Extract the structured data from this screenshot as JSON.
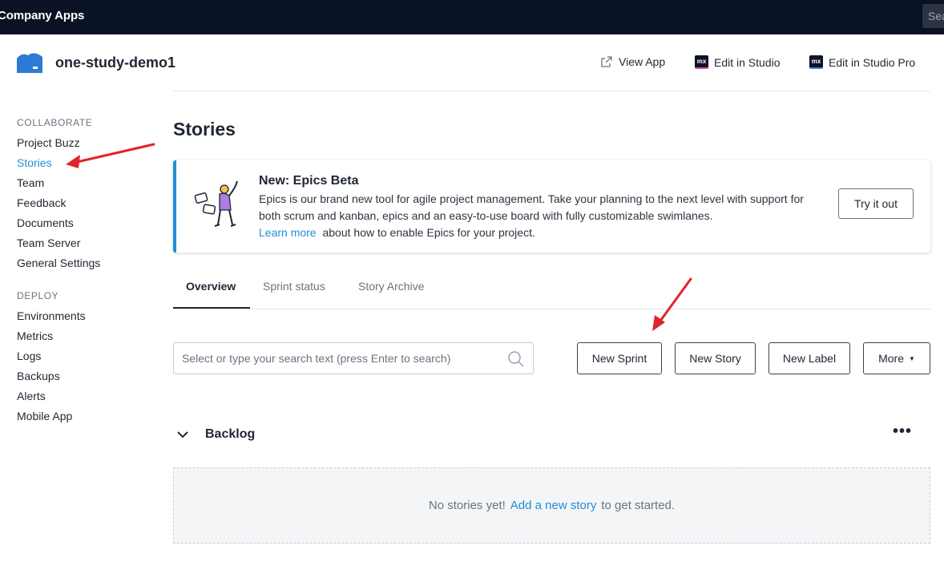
{
  "topbar": {
    "brand": "Company Apps",
    "search_text": "Search"
  },
  "app": {
    "name": "one-study-demo1",
    "links": {
      "view_app": "View App",
      "edit_in_studio": "Edit in Studio",
      "edit_in_studio_pro": "Edit in Studio Pro"
    },
    "studio_icon_text": "mx"
  },
  "sidebar": {
    "collaborate_heading": "COLLABORATE",
    "collaborate_items": [
      "Project Buzz",
      "Stories",
      "Team",
      "Feedback",
      "Documents",
      "Team Server",
      "General Settings"
    ],
    "active_item": "Stories",
    "deploy_heading": "DEPLOY",
    "deploy_items": [
      "Environments",
      "Metrics",
      "Logs",
      "Backups",
      "Alerts",
      "Mobile App"
    ]
  },
  "page": {
    "title": "Stories"
  },
  "banner": {
    "title": "New: Epics Beta",
    "text": "Epics is our brand new tool for agile project management. Take your planning to the next level with support for both scrum and kanban, epics and an easy-to-use board with fully customizable swimlanes.",
    "learn_more": "Learn more",
    "learn_more_suffix": "about how to enable Epics for your project.",
    "button": "Try it out",
    "accent_color": "#1f8ed6"
  },
  "tabs": [
    {
      "label": "Overview",
      "active": true
    },
    {
      "label": "Sprint status",
      "active": false
    },
    {
      "label": "Story Archive",
      "active": false
    }
  ],
  "toolbar": {
    "search_placeholder": "Select or type your search text (press Enter to search)",
    "new_sprint": "New Sprint",
    "new_story": "New Story",
    "new_label": "New Label",
    "more": "More"
  },
  "backlog": {
    "title": "Backlog",
    "empty_text": "No stories yet!",
    "empty_link": "Add a new story",
    "empty_suffix": "to get started."
  },
  "annotations": {
    "arrow_color": "#e0242b"
  }
}
